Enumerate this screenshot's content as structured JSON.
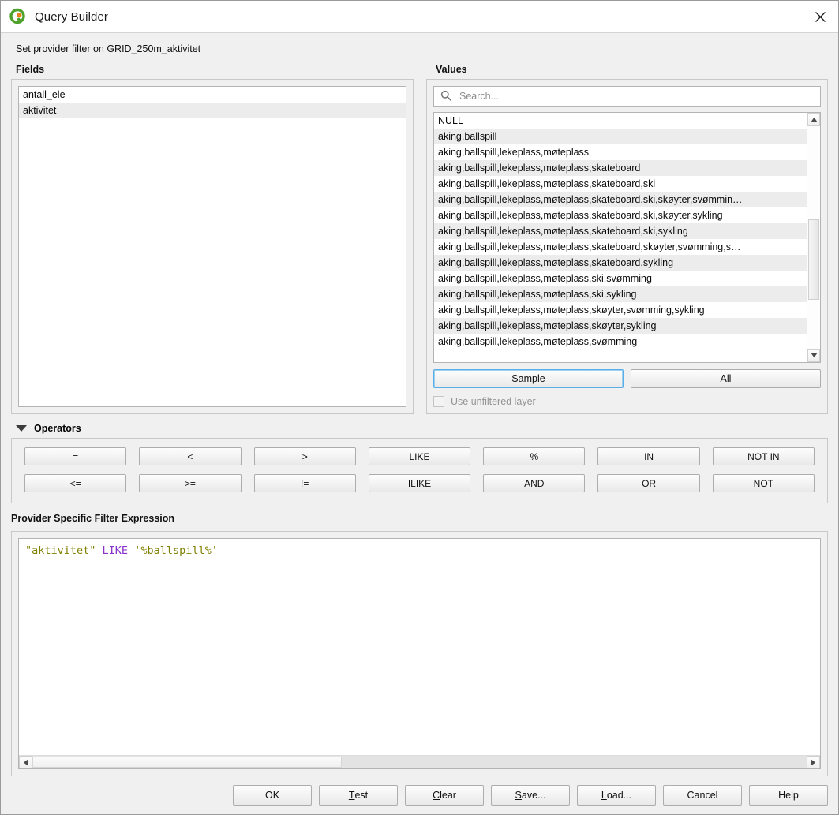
{
  "window": {
    "title": "Query Builder",
    "logo_icon": "qgis-logo-icon",
    "close_icon": "close-icon"
  },
  "subtitle": "Set provider filter on GRID_250m_aktivitet",
  "fields": {
    "label": "Fields",
    "items": [
      "antall_ele",
      "aktivitet"
    ]
  },
  "values": {
    "label": "Values",
    "search": {
      "placeholder": "Search...",
      "value": "",
      "icon": "search-icon"
    },
    "items": [
      "NULL",
      "aking,ballspill",
      "aking,ballspill,lekeplass,møteplass",
      "aking,ballspill,lekeplass,møteplass,skateboard",
      "aking,ballspill,lekeplass,møteplass,skateboard,ski",
      "aking,ballspill,lekeplass,møteplass,skateboard,ski,skøyter,svømmin…",
      "aking,ballspill,lekeplass,møteplass,skateboard,ski,skøyter,sykling",
      "aking,ballspill,lekeplass,møteplass,skateboard,ski,sykling",
      "aking,ballspill,lekeplass,møteplass,skateboard,skøyter,svømming,s…",
      "aking,ballspill,lekeplass,møteplass,skateboard,sykling",
      "aking,ballspill,lekeplass,møteplass,ski,svømming",
      "aking,ballspill,lekeplass,møteplass,ski,sykling",
      "aking,ballspill,lekeplass,møteplass,skøyter,svømming,sykling",
      "aking,ballspill,lekeplass,møteplass,skøyter,sykling",
      "aking,ballspill,lekeplass,møteplass,svømming"
    ],
    "sample_label": "Sample",
    "all_label": "All",
    "use_unfiltered_label": "Use unfiltered layer",
    "use_unfiltered_checked": false,
    "use_unfiltered_enabled": false,
    "scrollbar": {
      "up_icon": "scroll-up-icon",
      "down_icon": "scroll-down-icon",
      "thumb_top_pct": 42,
      "thumb_height_pct": 36
    }
  },
  "operators": {
    "label": "Operators",
    "expanded": true,
    "collapse_icon": "triangle-down-icon",
    "buttons": [
      "=",
      "<",
      ">",
      "LIKE",
      "%",
      "IN",
      "NOT IN",
      "<=",
      ">=",
      "!=",
      "ILIKE",
      "AND",
      "OR",
      "NOT"
    ]
  },
  "expression": {
    "label": "Provider Specific Filter Expression",
    "tokens": [
      {
        "text": "\"aktivitet\"",
        "type": "ident"
      },
      {
        "text": " ",
        "type": "plain"
      },
      {
        "text": "LIKE",
        "type": "kw"
      },
      {
        "text": " ",
        "type": "plain"
      },
      {
        "text": "'%ballspill%'",
        "type": "str"
      }
    ],
    "plain_text": "\"aktivitet\" LIKE '%ballspill%'",
    "scrollbar": {
      "left_icon": "scroll-left-icon",
      "right_icon": "scroll-right-icon",
      "thumb_left_pct": 0,
      "thumb_width_pct": 40
    }
  },
  "footer": {
    "buttons": [
      {
        "label": "OK",
        "mnemonic_index": -1
      },
      {
        "label": "Test",
        "mnemonic_index": 0
      },
      {
        "label": "Clear",
        "mnemonic_index": 0
      },
      {
        "label": "Save...",
        "mnemonic_index": 0
      },
      {
        "label": "Load...",
        "mnemonic_index": 0
      },
      {
        "label": "Cancel",
        "mnemonic_index": -1
      },
      {
        "label": "Help",
        "mnemonic_index": -1
      }
    ]
  },
  "colors": {
    "dialog_bg": "#f0f0f0",
    "list_alt_row": "#ececec",
    "focus_blue": "#5aaee8",
    "token_ident": "#808000",
    "token_keyword": "#8833cc",
    "logo_green": "#4fa22b",
    "logo_orange": "#e8811a"
  }
}
